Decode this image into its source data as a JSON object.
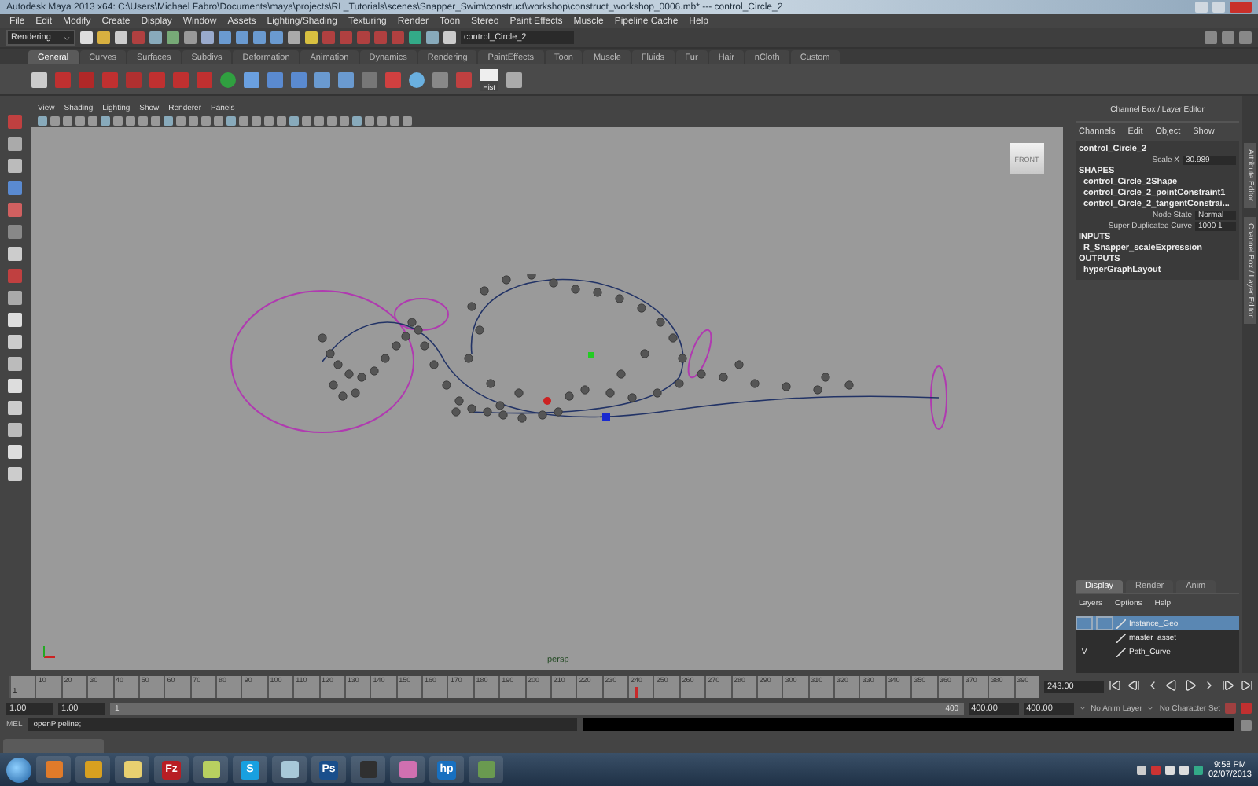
{
  "window": {
    "title": "Autodesk Maya 2013 x64: C:\\Users\\Michael Fabro\\Documents\\maya\\projects\\RL_Tutorials\\scenes\\Snapper_Swim\\construct\\workshop\\construct_workshop_0006.mb*   ---   control_Circle_2"
  },
  "menu_bar": [
    "File",
    "Edit",
    "Modify",
    "Create",
    "Display",
    "Window",
    "Assets",
    "Lighting/Shading",
    "Texturing",
    "Render",
    "Toon",
    "Stereo",
    "Paint Effects",
    "Muscle",
    "Pipeline Cache",
    "Help"
  ],
  "status_line": {
    "menu_set": "Rendering",
    "selection_field": "control_Circle_2"
  },
  "shelf": {
    "tabs": [
      {
        "label": "General",
        "selected": true
      },
      {
        "label": "Curves",
        "selected": false
      },
      {
        "label": "Surfaces",
        "selected": false
      },
      {
        "label": "Subdivs",
        "selected": false
      },
      {
        "label": "Deformation",
        "selected": false
      },
      {
        "label": "Animation",
        "selected": false
      },
      {
        "label": "Dynamics",
        "selected": false
      },
      {
        "label": "Rendering",
        "selected": false
      },
      {
        "label": "PaintEffects",
        "selected": false
      },
      {
        "label": "Toon",
        "selected": false
      },
      {
        "label": "Muscle",
        "selected": false
      },
      {
        "label": "Fluids",
        "selected": false
      },
      {
        "label": "Fur",
        "selected": false
      },
      {
        "label": "Hair",
        "selected": false
      },
      {
        "label": "nCloth",
        "selected": false
      },
      {
        "label": "Custom",
        "selected": false
      }
    ],
    "labelled_button": "Hist"
  },
  "viewport": {
    "menus": [
      "View",
      "Shading",
      "Lighting",
      "Show",
      "Renderer",
      "Panels"
    ],
    "view_cube_label": "FRONT",
    "camera_label": "persp"
  },
  "channel_box": {
    "title": "Channel Box / Layer Editor",
    "menus": [
      "Channels",
      "Edit",
      "Object",
      "Show"
    ],
    "object": "control_Circle_2",
    "attributes": [
      {
        "name": "Scale X",
        "value": "30.989"
      }
    ],
    "shapes_header": "SHAPES",
    "shapes": [
      "control_Circle_2Shape",
      "control_Circle_2_pointConstraint1",
      "control_Circle_2_tangentConstrai..."
    ],
    "shape_attributes": [
      {
        "name": "Node State",
        "value": "Normal"
      },
      {
        "name": "Super Duplicated Curve",
        "value": "1000 1"
      }
    ],
    "inputs_header": "INPUTS",
    "inputs": [
      "R_Snapper_scaleExpression"
    ],
    "outputs_header": "OUTPUTS",
    "outputs": [
      "hyperGraphLayout"
    ]
  },
  "layer_editor": {
    "tabs": [
      {
        "label": "Display",
        "selected": true
      },
      {
        "label": "Render",
        "selected": false
      },
      {
        "label": "Anim",
        "selected": false
      }
    ],
    "menus": [
      "Layers",
      "Options",
      "Help"
    ],
    "layers": [
      {
        "name": "Instance_Geo",
        "selected": true
      },
      {
        "name": "master_asset",
        "selected": false
      },
      {
        "name": "Path_Curve",
        "selected": false,
        "visibility_flag": "V"
      }
    ]
  },
  "vertical_tabs": [
    "Attribute Editor",
    "Channel Box / Layer Editor"
  ],
  "time_slider": {
    "start_frame": "1",
    "ticks": [
      "10",
      "20",
      "30",
      "40",
      "50",
      "60",
      "70",
      "80",
      "90",
      "100",
      "110",
      "120",
      "130",
      "140",
      "150",
      "160",
      "170",
      "180",
      "190",
      "200",
      "210",
      "220",
      "230",
      "240",
      "250",
      "260",
      "270",
      "280",
      "290",
      "300",
      "310",
      "320",
      "330",
      "340",
      "350",
      "360",
      "370",
      "380",
      "390"
    ],
    "current_frame": "243.00",
    "level": 0.6075
  },
  "range_slider": {
    "start_time": "1.00",
    "playback_start": "1.00",
    "range_start": "1",
    "range_end": "400",
    "level": 1,
    "playback_end": "400.00",
    "end_time": "400.00",
    "anim_layer": "No Anim Layer",
    "character_set": "No Character Set"
  },
  "command_line": {
    "language": "MEL",
    "command": "openPipeline;"
  },
  "taskbar": {
    "apps": [
      {
        "kind": "tile",
        "color": "#e07b2a"
      },
      {
        "kind": "tile",
        "color": "#d8a020"
      },
      {
        "kind": "tile",
        "color": "#e8d070"
      },
      {
        "kind": "glyph",
        "label": "Fz",
        "color": "#b81e24"
      },
      {
        "kind": "tile",
        "color": "#b8d060"
      },
      {
        "kind": "glyph",
        "label": "S",
        "color": "#18a0e0"
      },
      {
        "kind": "tile",
        "color": "#a8c8d8"
      },
      {
        "kind": "glyph",
        "label": "Ps",
        "color": "#1a4f8c"
      },
      {
        "kind": "tile",
        "color": "#303030"
      },
      {
        "kind": "tile",
        "color": "#d070b0"
      },
      {
        "kind": "glyph",
        "label": "hp",
        "color": "#1870c0"
      },
      {
        "kind": "tile",
        "color": "#6a9a50"
      }
    ],
    "clock_time": "9:58 PM",
    "clock_date": "02/07/2013"
  }
}
